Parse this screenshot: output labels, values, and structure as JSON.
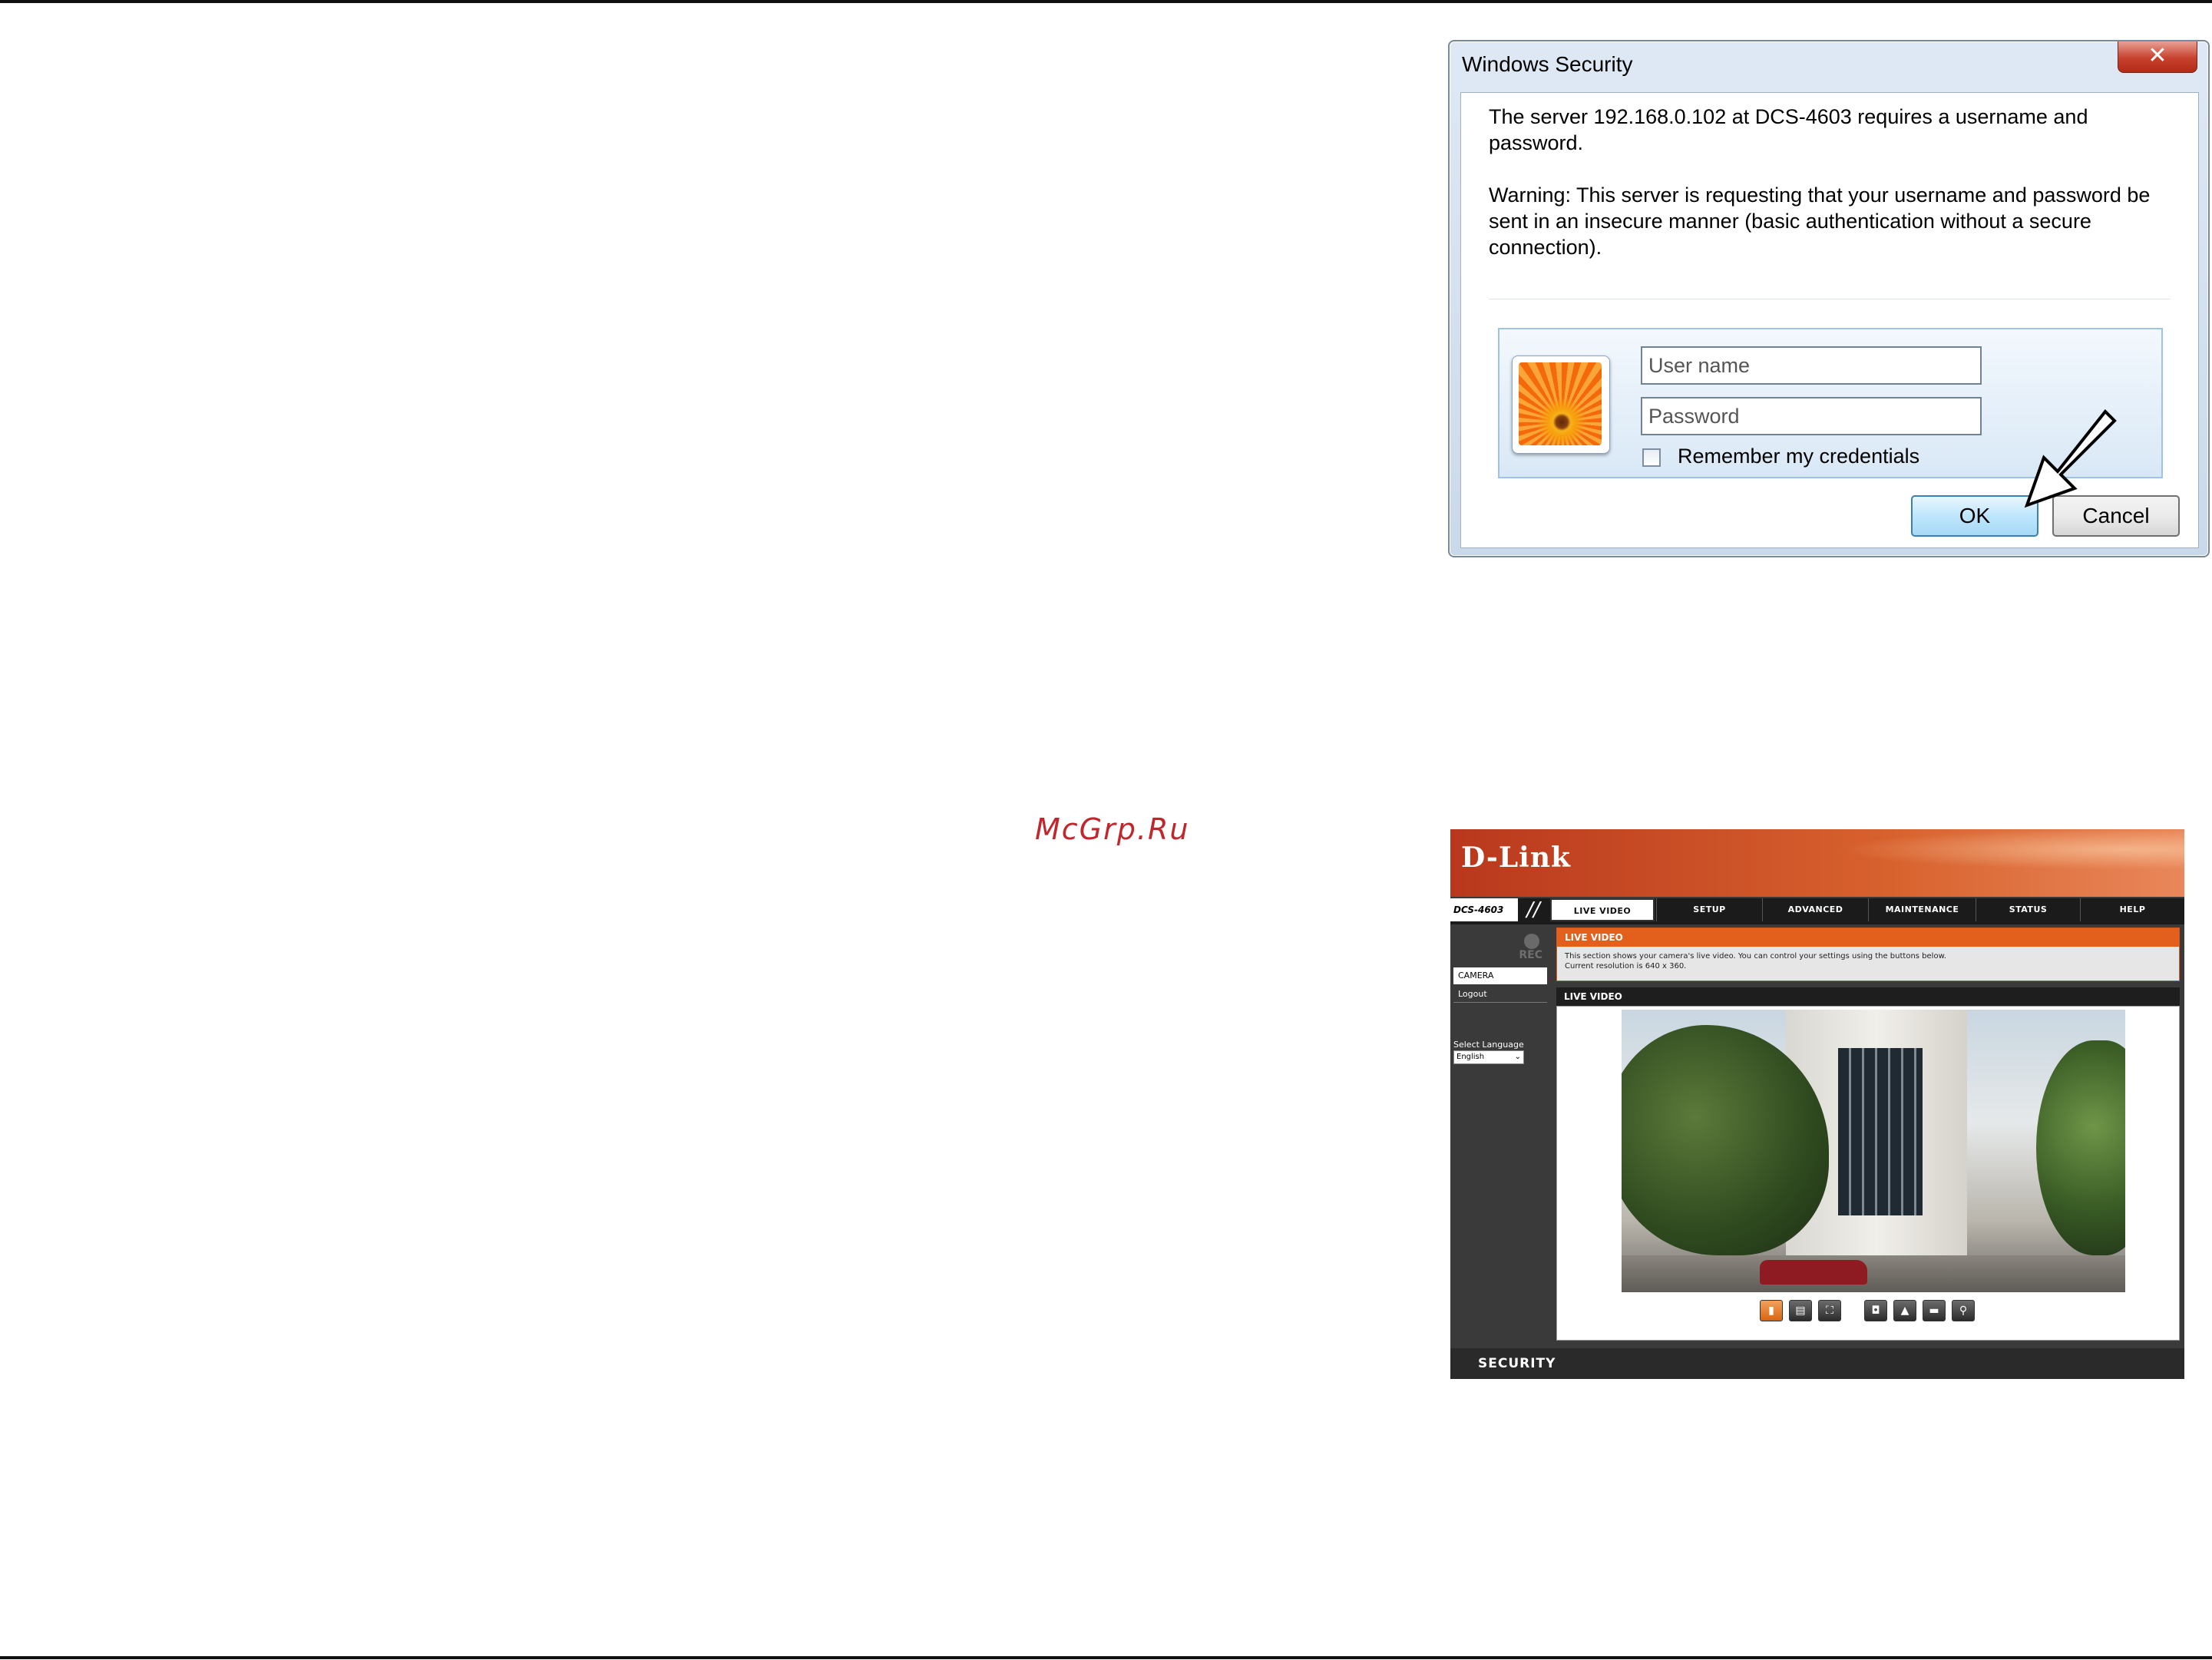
{
  "watermark": "McGrp.Ru",
  "dialog": {
    "title": "Windows Security",
    "close_label": "✕",
    "message": "The server 192.168.0.102 at DCS-4603 requires a username and password.",
    "warning": "Warning: This server is requesting that your username and password be sent in an insecure manner (basic authentication without a secure connection).",
    "username_placeholder": "User name",
    "password_placeholder": "Password",
    "remember_label": "Remember my credentials",
    "ok_label": "OK",
    "cancel_label": "Cancel",
    "remember_checked": false
  },
  "dlink": {
    "logo": "D-Link",
    "model": "DCS-4603",
    "slash": "//",
    "tabs": [
      {
        "label": "LIVE VIDEO",
        "active": true
      },
      {
        "label": "SETUP",
        "active": false
      },
      {
        "label": "ADVANCED",
        "active": false
      },
      {
        "label": "MAINTENANCE",
        "active": false
      },
      {
        "label": "STATUS",
        "active": false
      },
      {
        "label": "HELP",
        "active": false
      }
    ],
    "rec_label": "REC",
    "sidebar": {
      "camera": "CAMERA",
      "logout": "Logout",
      "language_label": "Select Language",
      "language_value": "English"
    },
    "info": {
      "title": "LIVE VIDEO",
      "line1": "This section shows your camera's live video. You can control your settings using the buttons below.",
      "line2": "Current resolution is 640 x 360."
    },
    "live_title": "LIVE VIDEO",
    "footer": "SECURITY",
    "controls": [
      "view-icon",
      "profile-icon",
      "fullscreen-icon",
      "snapshot-icon",
      "record-icon",
      "storage-icon",
      "zoom-icon"
    ]
  },
  "colors": {
    "dlink_orange": "#e2601c",
    "dlink_dark": "#3a3a3a",
    "ok_border": "#3c7fb1"
  }
}
